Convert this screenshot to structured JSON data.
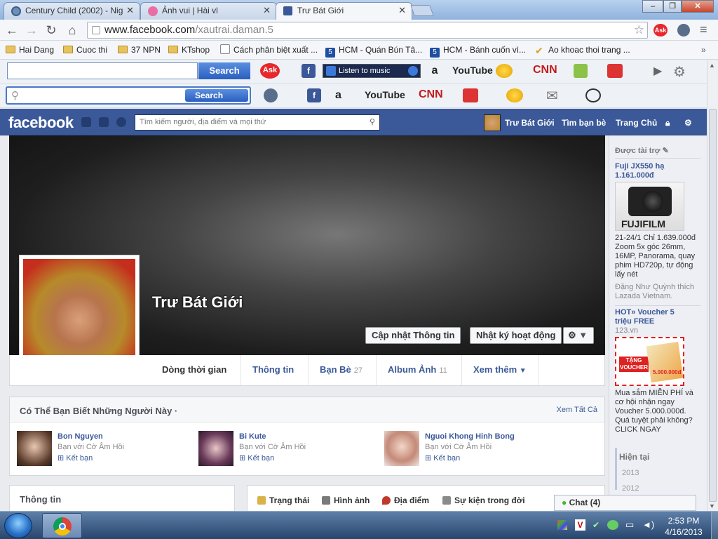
{
  "browser": {
    "tabs": [
      {
        "title": "Century Child (2002) - Nig",
        "active": false
      },
      {
        "title": "Ảnh vui | Hài vl",
        "active": false
      },
      {
        "title": "Trư Bát Giới",
        "active": true
      }
    ],
    "url_domain": "www.facebook.com",
    "url_path": "/xautrai.daman.5",
    "window_buttons": {
      "minimize": "–",
      "maximize": "❐",
      "close": "✕"
    }
  },
  "bookmarks": [
    {
      "label": "Hai Dang",
      "icon": "folder-icon"
    },
    {
      "label": "Cuoc thi",
      "icon": "folder-icon"
    },
    {
      "label": "37 NPN",
      "icon": "folder-icon"
    },
    {
      "label": "KTshop",
      "icon": "folder-icon"
    },
    {
      "label": "Cách phân biệt xuất ...",
      "icon": "page-icon"
    },
    {
      "label": "HCM - Quán Bún Tâ...",
      "icon": "five-icon"
    },
    {
      "label": "HCM - Bánh cuốn vì...",
      "icon": "five-icon"
    },
    {
      "label": "Ao khoac thoi trang ...",
      "icon": "check-icon"
    }
  ],
  "toolbar1": {
    "search_button": "Search",
    "ask": "Ask",
    "listen": "Listen to music",
    "youtube": "YouTube",
    "cnn": "CNN"
  },
  "toolbar2": {
    "search_button": "Search",
    "youtube": "YouTube",
    "cnn": "CNN"
  },
  "facebook": {
    "logo": "facebook",
    "search_placeholder": "Tìm kiếm người, địa điểm và mọi thứ",
    "nav": {
      "profile": "Trư Bát Giới",
      "find_friends": "Tìm bạn bè",
      "home": "Trang Chủ"
    },
    "profile_name": "Trư Bát Giới",
    "cover_buttons": {
      "update_info": "Cập nhật Thông tin",
      "activity_log": "Nhật ký hoạt động"
    },
    "tabs": [
      {
        "label": "Dòng thời gian",
        "count": ""
      },
      {
        "label": "Thông tin",
        "count": ""
      },
      {
        "label": "Bạn Bè",
        "count": "27"
      },
      {
        "label": "Album Ảnh",
        "count": "11"
      },
      {
        "label": "Xem thêm",
        "count": ""
      }
    ],
    "pymk": {
      "title": "Có Thể Bạn Biết Những Người Này ·",
      "see_all": "Xem Tất Cả",
      "people": [
        {
          "name": "Bon Nguyen",
          "sub": "Bạn với Cờ Âm Hồi",
          "add": "Kết bạn"
        },
        {
          "name": "Bi Kute",
          "sub": "Bạn với Cờ Âm Hồi",
          "add": "Kết bạn"
        },
        {
          "name": "Nguoi Khong Hinh Bong",
          "sub": "Bạn với Cờ Âm Hồi",
          "add": "Kết bạn"
        }
      ]
    },
    "info_title": "Thông tin",
    "composer": [
      {
        "label": "Trạng thái"
      },
      {
        "label": "Hình ảnh"
      },
      {
        "label": "Địa điểm"
      },
      {
        "label": "Sự kiện trong đời"
      }
    ],
    "sidebar": {
      "sponsored": "Được tài trợ",
      "ad1_title": "Fuji JX550 hạ 1.161.000đ",
      "ad1_brand": "FUJIFILM",
      "ad1_text": "21-24/1 Chỉ 1.639.000đ Zoom 5x góc 26mm, 16MP, Panorama, quay phim HD720p, tự động lấy nét",
      "ad1_social": "Đặng Như Quỳnh thích Lazada Vietnam.",
      "ad2_title": "HOT» Voucher 5 triệu FREE",
      "ad2_domain": "123.vn",
      "ad2_img1": "TẶNG VOUCHER",
      "ad2_img2": "5.000.000đ",
      "ad2_text": "Mua sắm MIỄN PHÍ và cơ hội nhận ngay Voucher 5.000.000đ. Quá tuyệt phải không? CLICK NGAY",
      "timeline": [
        "Hiện tại",
        "2013",
        "2012"
      ]
    },
    "chat": "Chat (4)"
  },
  "taskbar": {
    "time": "2:53 PM",
    "date": "4/16/2013"
  }
}
